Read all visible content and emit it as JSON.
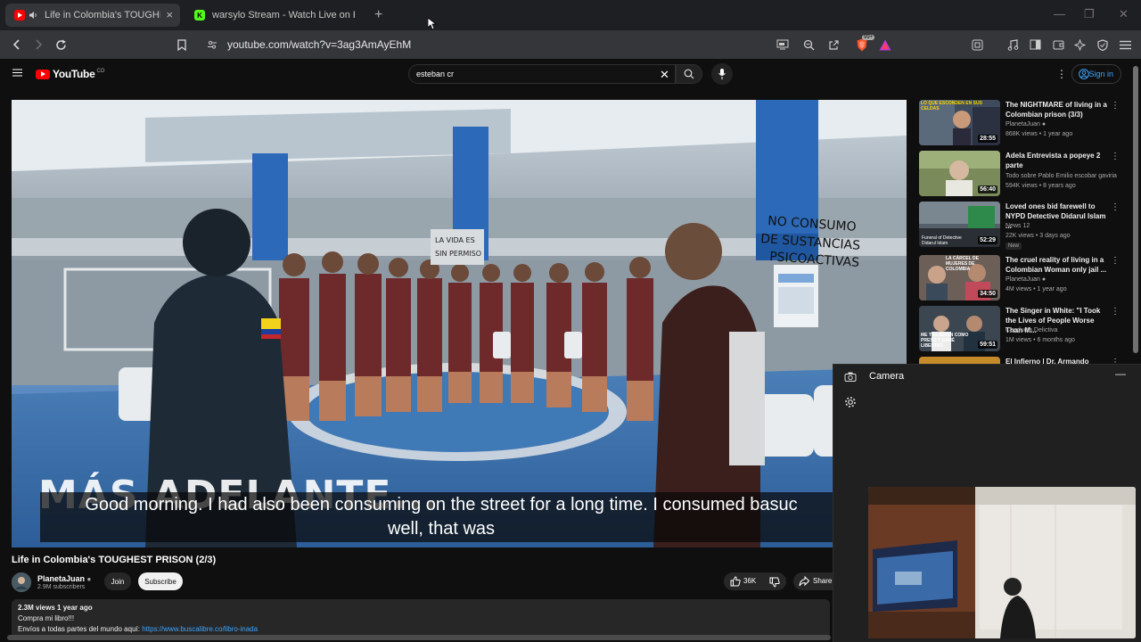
{
  "browser": {
    "tabs": [
      {
        "title": "Life in Colombia's TOUGHEST",
        "active": true,
        "favicon": "youtube-icon"
      },
      {
        "title": "warsylo Stream - Watch Live on Kick",
        "active": false,
        "favicon": "kick-icon"
      }
    ],
    "url": "youtube.com/watch?v=3ag3AmAyEhM",
    "brave_badge": "99+"
  },
  "youtube": {
    "logo_text": "YouTube",
    "logo_country": "CO",
    "search_value": "esteban cr",
    "signin_label": "Sign in",
    "video": {
      "caption_line1": "Good morning. I had also been consuming on the street for a long time. I consumed basuc",
      "caption_line2": "well, that was",
      "overlay_text": "MÁS ADELANTE...",
      "wall_sign": "NO CONSUMO DE SUSTANCIAS PSICOACTIVAS",
      "pillar_sign": "LA VIDA ES SIN PERMISO"
    },
    "title": "Life in Colombia's TOUGHEST PRISON (2/3)",
    "channel": {
      "name": "PlanetaJuan",
      "subscribers": "2.9M subscribers"
    },
    "join_label": "Join",
    "subscribe_label": "Subscribe",
    "like_count": "36K",
    "share_label": "Share",
    "description": {
      "stats": "2.3M views  1 year ago",
      "line1": "Compra mi libro!!!",
      "line2_text": "Envíos a todas partes del mundo aquí:",
      "line2_link": "https://www.buscalibre.co/libro-inada"
    },
    "recommendations": [
      {
        "title": "The NIGHTMARE of living in a Colombian prison (3/3)",
        "channel": "PlanetaJuan",
        "verified": true,
        "meta": "868K views • 1 year ago",
        "duration": "28:55",
        "thumb_text": "LO QUE ESCONDEN EN SUS CELDAS",
        "badge": ""
      },
      {
        "title": "Adela Entrevista a popeye 2 parte",
        "channel": "Todo sobre Pablo Emilio escobar gaviria",
        "verified": false,
        "meta": "594K views • 8 years ago",
        "duration": "56:40",
        "thumb_text": "",
        "badge": ""
      },
      {
        "title": "Loved ones bid farewell to NYPD Detective Didarul Islam ...",
        "channel": "News 12",
        "verified": false,
        "meta": "22K views • 3 days ago",
        "duration": "52:29",
        "thumb_text": "Funeral of Detective Didarul Islam",
        "badge": "New"
      },
      {
        "title": "The cruel reality of living in a Colombian Woman only jail ...",
        "channel": "PlanetaJuan",
        "verified": true,
        "meta": "4M views • 1 year ago",
        "duration": "34:50",
        "thumb_text": "LA CÁRCEL DE MUJERES DE COLOMBIA",
        "badge": ""
      },
      {
        "title": "The Singer in White: \"I Took the Lives of People Worse Than M...",
        "channel": "Conducta Delictiva",
        "verified": false,
        "meta": "1M views • 6 months ago",
        "duration": "59:51",
        "thumb_text": "ME TRAJERON COMO PRESO Y GANÉ LIBERTAD",
        "badge": ""
      },
      {
        "title": "El Infierno | Dr. Armando",
        "channel": "",
        "verified": false,
        "meta": "",
        "duration": "",
        "thumb_text": "",
        "badge": ""
      }
    ]
  },
  "camera_app": {
    "title": "Camera"
  },
  "colors": {
    "youtube_red": "#ff0000",
    "kick_green": "#53fc18",
    "link_blue": "#3ea6ff"
  }
}
